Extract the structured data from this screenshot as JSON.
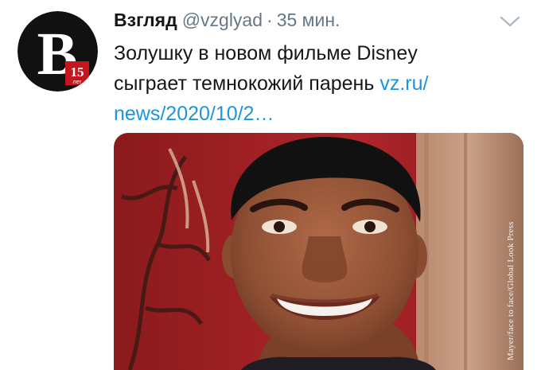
{
  "tweet": {
    "author": {
      "display_name": "Взгляд",
      "handle": "@vzglyad",
      "separator": "·",
      "time": "35 мин.",
      "avatar": {
        "letter": "B",
        "badge_number": "15",
        "badge_text": "лет",
        "colors": {
          "bg": "#111111",
          "badge": "#c4161c"
        }
      }
    },
    "menu_icon": "chevron-down-icon",
    "text": {
      "line1": "Золушку в новом фильме Disney",
      "line2_plain": "сыграет темнокожий парень ",
      "link_part1": "vz.ru/",
      "link_part2": "news/2020/10/2…"
    },
    "media": {
      "description_hidden": "",
      "credit": "Mayer/face to face/Global Look Press"
    },
    "colors": {
      "name": "#14171a",
      "secondary": "#657786",
      "link": "#1b95e0"
    }
  }
}
